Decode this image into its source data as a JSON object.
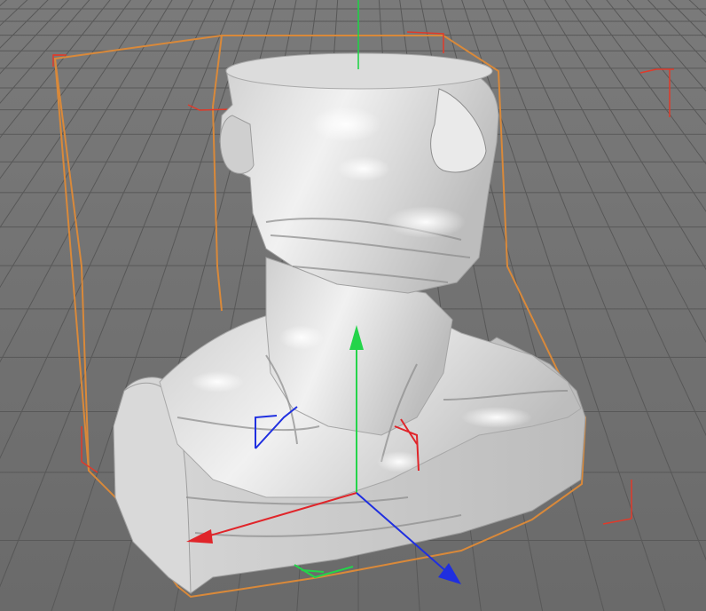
{
  "viewport": {
    "background_color": "#6f6f6f",
    "grid_color": "#585858",
    "selection_outline_color": "#d9893a",
    "bbox_corner_color": "#e03a2a",
    "mesh_color": "#e6e6e6"
  },
  "axes": {
    "x_color": "#e0252a",
    "y_color": "#24d44a",
    "z_color": "#1f2fe0"
  },
  "objects": [
    {
      "name": "sculpted-bust",
      "type": "mesh",
      "selected": true
    }
  ],
  "icons": [
    "move-gizmo",
    "rotate-gizmo-marker",
    "bounding-box-corner"
  ]
}
